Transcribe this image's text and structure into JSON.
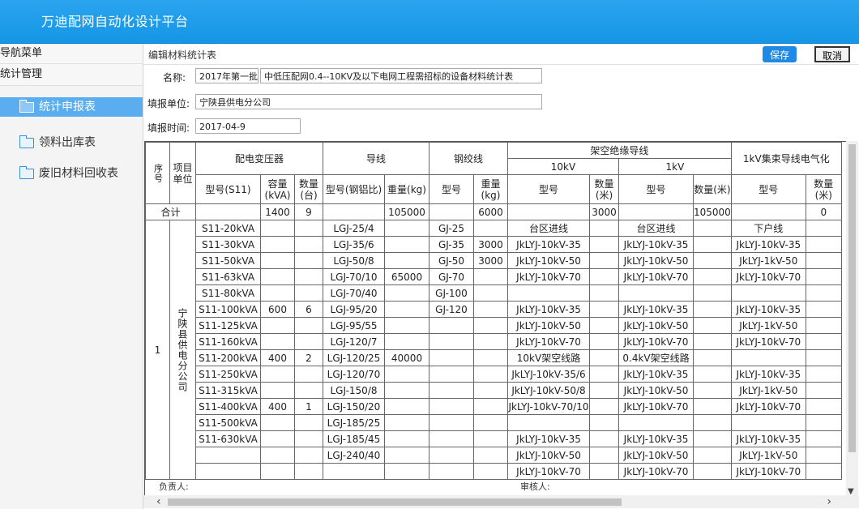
{
  "app": {
    "title": "万迪配网自动化设计平台"
  },
  "sidebar": {
    "header": "导航菜单",
    "section": "统计管理",
    "items": [
      {
        "label": "统计申报表",
        "icon": "folder-icon",
        "active": true
      },
      {
        "label": "领料出库表",
        "icon": "folder-icon",
        "active": false
      },
      {
        "label": "废旧材料回收表",
        "icon": "folder-icon",
        "active": false
      }
    ]
  },
  "main": {
    "title": "编辑材料统计表",
    "save_label": "保存",
    "cancel_label": "取消",
    "form": {
      "name_label": "名称:",
      "name_prefix": "2017年第一批",
      "name_value": "中低压配网0.4--10KV及以下电网工程需招标的设备材料统计表",
      "unit_label": "填报单位:",
      "unit_value": "宁陕县供电分公司",
      "date_label": "填报时间:",
      "date_value": "2017-04-9"
    },
    "footer": {
      "responsible": "负责人:",
      "reviewer": "审核人:"
    }
  },
  "table": {
    "h": {
      "seq": "序号",
      "unit": "项目单位",
      "transformer": "配电变压器",
      "wire": "导线",
      "steel": "钢绞线",
      "overhead": "架空绝缘导线",
      "ten_kv": "10kV",
      "one_kv": "1kV",
      "bundle": "1kV集束导线电气化",
      "model_s11": "型号(S11)",
      "capacity": "容量(kVA)",
      "count_tai": "数量(台)",
      "wire_model": "型号(钢铝比)",
      "weight_kg": "重量(kg)",
      "model": "型号",
      "weight_t": "重量(kg)",
      "ten_model": "型号",
      "ten_qty": "数量(米)",
      "one_model": "型号",
      "one_qty": "数量(米)",
      "b_model": "型号",
      "b_qty": "数量(米)"
    },
    "total": {
      "label": "合计",
      "cap": "1400",
      "cnt": "9",
      "wire_w": "105000",
      "steel_w": "6000",
      "ten_qty": "3000",
      "one_qty": "105000",
      "b_qty": "0"
    },
    "row_seq": "1",
    "row_unit": "宁陕县供电分公司",
    "rows": [
      [
        "S11-20kVA",
        "",
        "",
        "LGJ-25/4",
        "",
        "GJ-25",
        "",
        "台区进线",
        "",
        "台区进线",
        "",
        "下户线",
        ""
      ],
      [
        "S11-30kVA",
        "",
        "",
        "LGJ-35/6",
        "",
        "GJ-35",
        "3000",
        "JkLYJ-10kV-35",
        "",
        "JkLYJ-10kV-35",
        "",
        "JkLYJ-10kV-35",
        ""
      ],
      [
        "S11-50kVA",
        "",
        "",
        "LGJ-50/8",
        "",
        "GJ-50",
        "3000",
        "JkLYJ-10kV-50",
        "",
        "JkLYJ-10kV-50",
        "",
        "JkLYJ-1kV-50",
        ""
      ],
      [
        "S11-63kVA",
        "",
        "",
        "LGJ-70/10",
        "65000",
        "GJ-70",
        "",
        "JkLYJ-10kV-70",
        "",
        "JkLYJ-10kV-70",
        "",
        "JkLYJ-10kV-70",
        ""
      ],
      [
        "S11-80kVA",
        "",
        "",
        "LGJ-70/40",
        "",
        "GJ-100",
        "",
        "",
        "",
        "",
        "",
        "",
        ""
      ],
      [
        "S11-100kVA",
        "600",
        "6",
        "LGJ-95/20",
        "",
        "GJ-120",
        "",
        "JkLYJ-10kV-35",
        "",
        "JkLYJ-10kV-35",
        "",
        "JkLYJ-10kV-35",
        ""
      ],
      [
        "S11-125kVA",
        "",
        "",
        "LGJ-95/55",
        "",
        "",
        "",
        "JkLYJ-10kV-50",
        "",
        "JkLYJ-10kV-50",
        "",
        "JkLYJ-1kV-50",
        ""
      ],
      [
        "S11-160kVA",
        "",
        "",
        "LGJ-120/7",
        "",
        "",
        "",
        "JkLYJ-10kV-70",
        "",
        "JkLYJ-10kV-70",
        "",
        "JkLYJ-10kV-70",
        ""
      ],
      [
        "S11-200kVA",
        "400",
        "2",
        "LGJ-120/25",
        "40000",
        "",
        "",
        "10kV架空线路",
        "",
        "0.4kV架空线路",
        "",
        "",
        ""
      ],
      [
        "S11-250kVA",
        "",
        "",
        "LGJ-120/70",
        "",
        "",
        "",
        "JkLYJ-10kV-35/6",
        "",
        "JkLYJ-10kV-35",
        "",
        "JkLYJ-10kV-35",
        ""
      ],
      [
        "S11-315kVA",
        "",
        "",
        "LGJ-150/8",
        "",
        "",
        "",
        "JkLYJ-10kV-50/8",
        "",
        "JkLYJ-10kV-50",
        "",
        "JkLYJ-1kV-50",
        ""
      ],
      [
        "S11-400kVA",
        "400",
        "1",
        "LGJ-150/20",
        "",
        "",
        "",
        "JkLYJ-10kV-70/10",
        "",
        "JkLYJ-10kV-70",
        "",
        "JkLYJ-10kV-70",
        ""
      ],
      [
        "S11-500kVA",
        "",
        "",
        "LGJ-185/25",
        "",
        "",
        "",
        "",
        "",
        "",
        "",
        "",
        ""
      ],
      [
        "S11-630kVA",
        "",
        "",
        "LGJ-185/45",
        "",
        "",
        "",
        "JkLYJ-10kV-35",
        "",
        "JkLYJ-10kV-35",
        "",
        "JkLYJ-10kV-35",
        ""
      ],
      [
        "",
        "",
        "",
        "LGJ-240/40",
        "",
        "",
        "",
        "JkLYJ-10kV-50",
        "",
        "JkLYJ-10kV-50",
        "",
        "JkLYJ-1kV-50",
        ""
      ],
      [
        "",
        "",
        "",
        "",
        "",
        "",
        "",
        "JkLYJ-10kV-70",
        "",
        "JkLYJ-10kV-70",
        "",
        "JkLYJ-10kV-70",
        ""
      ]
    ]
  }
}
